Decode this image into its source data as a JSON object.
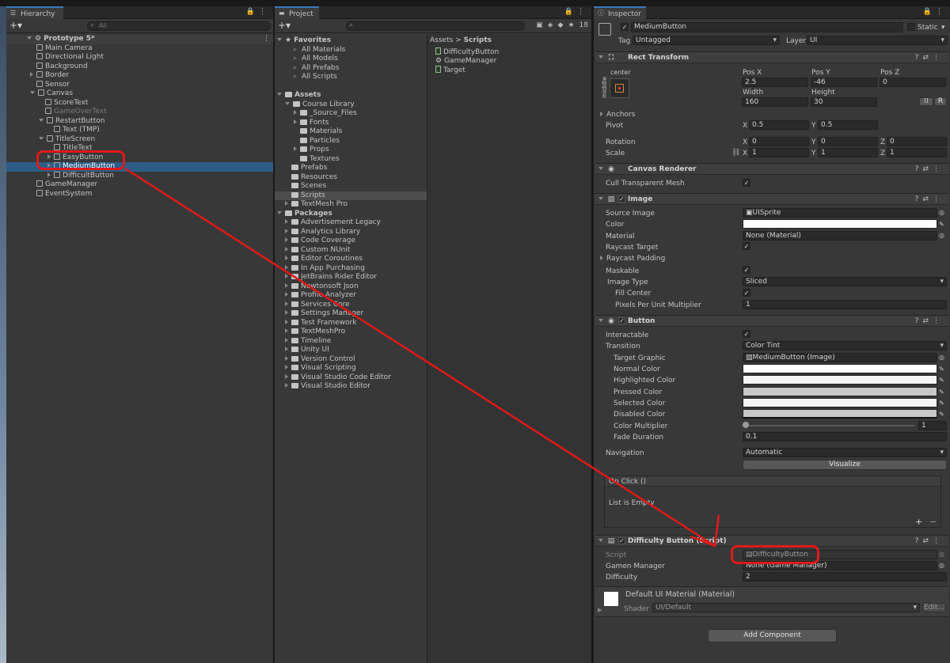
{
  "hierarchy": {
    "tab": "Hierarchy",
    "search_placeholder": "All",
    "scene": "Prototype 5*",
    "items": [
      {
        "label": "Main Camera",
        "indent": 1,
        "exp": ""
      },
      {
        "label": "Directional Light",
        "indent": 1,
        "exp": ""
      },
      {
        "label": "Background",
        "indent": 1,
        "exp": ""
      },
      {
        "label": "Border",
        "indent": 1,
        "exp": "closed"
      },
      {
        "label": "Sensor",
        "indent": 1,
        "exp": ""
      },
      {
        "label": "Canvas",
        "indent": 1,
        "exp": "open"
      },
      {
        "label": "ScoreText",
        "indent": 2,
        "exp": ""
      },
      {
        "label": "GameOverText",
        "indent": 2,
        "exp": "",
        "dim": true
      },
      {
        "label": "RestartButton",
        "indent": 2,
        "exp": "open"
      },
      {
        "label": "Text (TMP)",
        "indent": 3,
        "exp": ""
      },
      {
        "label": "TitleScreen",
        "indent": 2,
        "exp": "open"
      },
      {
        "label": "TitleText",
        "indent": 3,
        "exp": ""
      },
      {
        "label": "EasyButton",
        "indent": 3,
        "exp": "closed"
      },
      {
        "label": "MediumButton",
        "indent": 3,
        "exp": "closed",
        "selected": true
      },
      {
        "label": "DifficultButton",
        "indent": 3,
        "exp": "closed"
      },
      {
        "label": "GameManager",
        "indent": 1,
        "exp": ""
      },
      {
        "label": "EventSystem",
        "indent": 1,
        "exp": ""
      }
    ]
  },
  "project": {
    "tab": "Project",
    "hidden_count": "18",
    "favorites": {
      "label": "Favorites",
      "items": [
        "All Materials",
        "All Models",
        "All Prefabs",
        "All Scripts"
      ]
    },
    "assets_label": "Assets",
    "assets": [
      {
        "label": "Course Library",
        "indent": 1,
        "exp": "open"
      },
      {
        "label": "_Source_Files",
        "indent": 2,
        "exp": "closed"
      },
      {
        "label": "Fonts",
        "indent": 2,
        "exp": "closed"
      },
      {
        "label": "Materials",
        "indent": 2,
        "exp": ""
      },
      {
        "label": "Particles",
        "indent": 2,
        "exp": ""
      },
      {
        "label": "Props",
        "indent": 2,
        "exp": "closed"
      },
      {
        "label": "Textures",
        "indent": 2,
        "exp": ""
      },
      {
        "label": "Prefabs",
        "indent": 1,
        "exp": ""
      },
      {
        "label": "Resources",
        "indent": 1,
        "exp": ""
      },
      {
        "label": "Scenes",
        "indent": 1,
        "exp": ""
      },
      {
        "label": "Scripts",
        "indent": 1,
        "exp": "",
        "selected": true
      },
      {
        "label": "TextMesh Pro",
        "indent": 1,
        "exp": "closed"
      }
    ],
    "packages_label": "Packages",
    "packages": [
      "Advertisement Legacy",
      "Analytics Library",
      "Code Coverage",
      "Custom NUnit",
      "Editor Coroutines",
      "In App Purchasing",
      "JetBrains Rider Editor",
      "Newtonsoft Json",
      "Profile Analyzer",
      "Services Core",
      "Settings Manager",
      "Test Framework",
      "TextMeshPro",
      "Timeline",
      "Unity UI",
      "Version Control",
      "Visual Scripting",
      "Visual Studio Code Editor",
      "Visual Studio Editor"
    ],
    "breadcrumb": [
      "Assets",
      "Scripts"
    ],
    "files": [
      {
        "label": "DifficultyButton",
        "icon": "script"
      },
      {
        "label": "GameManager",
        "icon": "gear"
      },
      {
        "label": "Target",
        "icon": "script"
      }
    ]
  },
  "inspector": {
    "tab": "Inspector",
    "object_name": "MediumButton",
    "static_label": "Static",
    "tag_label": "Tag",
    "tag_value": "Untagged",
    "layer_label": "Layer",
    "layer_value": "UI",
    "rect": {
      "title": "Rect Transform",
      "anchor_h": "center",
      "anchor_v": "middle",
      "posx_label": "Pos X",
      "posy_label": "Pos Y",
      "posz_label": "Pos Z",
      "posx": "2.5",
      "posy": "-46",
      "posz": "0",
      "width_label": "Width",
      "height_label": "Height",
      "width": "160",
      "height": "30",
      "raw_label": "R",
      "anchors_label": "Anchors",
      "pivot_label": "Pivot",
      "pivot_x": "0.5",
      "pivot_y": "0.5",
      "rotation_label": "Rotation",
      "rot_x": "0",
      "rot_y": "0",
      "rot_z": "0",
      "scale_label": "Scale",
      "scale_x": "1",
      "scale_y": "1",
      "scale_z": "1",
      "x": "X",
      "y": "Y",
      "z": "Z"
    },
    "canvas_renderer": {
      "title": "Canvas Renderer",
      "cull_label": "Cull Transparent Mesh"
    },
    "image": {
      "title": "Image",
      "source_label": "Source Image",
      "source_value": "UISprite",
      "color_label": "Color",
      "material_label": "Material",
      "material_value": "None (Material)",
      "raycast_target_label": "Raycast Target",
      "raycast_padding_label": "Raycast Padding",
      "maskable_label": "Maskable",
      "image_type_label": "Image Type",
      "image_type_value": "Sliced",
      "fill_center_label": "Fill Center",
      "ppu_label": "Pixels Per Unit Multiplier",
      "ppu_value": "1"
    },
    "button": {
      "title": "Button",
      "interactable_label": "Interactable",
      "transition_label": "Transition",
      "transition_value": "Color Tint",
      "target_graphic_label": "Target Graphic",
      "target_graphic_value": "MediumButton (Image)",
      "normal_label": "Normal Color",
      "highlighted_label": "Highlighted Color",
      "pressed_label": "Pressed Color",
      "selected_label": "Selected Color",
      "disabled_label": "Disabled Color",
      "normal_color": "#ffffff",
      "highlighted_color": "#f5f5f5",
      "pressed_color": "#c8c8c8",
      "selected_color": "#f5f5f5",
      "disabled_color": "#c8c8c8",
      "multiplier_label": "Color Multiplier",
      "multiplier_value": "1",
      "fade_label": "Fade Duration",
      "fade_value": "0.1",
      "navigation_label": "Navigation",
      "navigation_value": "Automatic",
      "visualize_label": "Visualize",
      "onclick_label": "On Click ()",
      "list_empty": "List is Empty"
    },
    "difficulty": {
      "title": "Difficulty Button (Script)",
      "script_label": "Script",
      "script_value": "DifficultyButton",
      "gm_label": "Gamen Manager",
      "gm_value": "None (Game Manager)",
      "difficulty_label": "Difficulty",
      "difficulty_value": "2"
    },
    "material": {
      "name": "Default UI Material (Material)",
      "shader_label": "Shader",
      "shader_value": "UI/Default",
      "edit_label": "Edit..."
    },
    "add_component": "Add Component"
  },
  "colors": {
    "annotation": "#e01919",
    "selection": "#2c5d87",
    "accent": "#3a79bb"
  }
}
